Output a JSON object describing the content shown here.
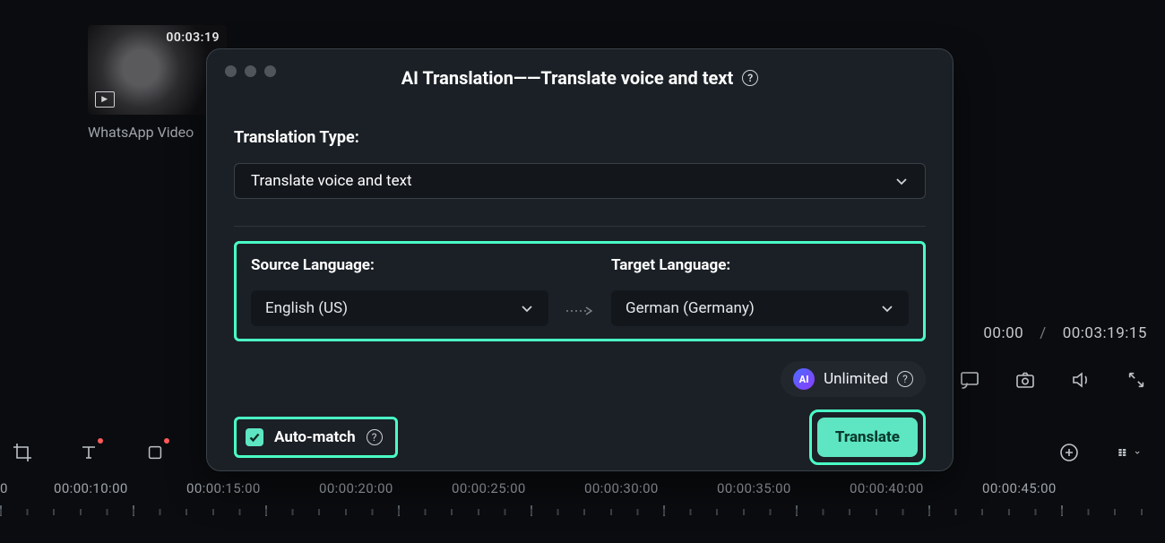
{
  "media": {
    "duration": "00:03:19",
    "caption": "WhatsApp Video"
  },
  "playback": {
    "current": "00:00",
    "total": "00:03:19:15",
    "separator": "/"
  },
  "modal": {
    "title": "AI Translation——Translate voice and text",
    "translation_type_label": "Translation Type:",
    "translation_type_value": "Translate voice and text",
    "source_label": "Source Language:",
    "target_label": "Target Language:",
    "source_value": "English (US)",
    "target_value": "German (Germany)",
    "unlimited_badge": "AI",
    "unlimited_text": "Unlimited",
    "automatch_label": "Auto-match",
    "translate_btn": "Translate"
  },
  "timeline": {
    "labels": [
      "0",
      "00:00:10:00",
      "00:00:15:00",
      "00:00:20:00",
      "00:00:25:00",
      "00:00:30:00",
      "00:00:35:00",
      "00:00:40:00",
      "00:00:45:00"
    ]
  }
}
